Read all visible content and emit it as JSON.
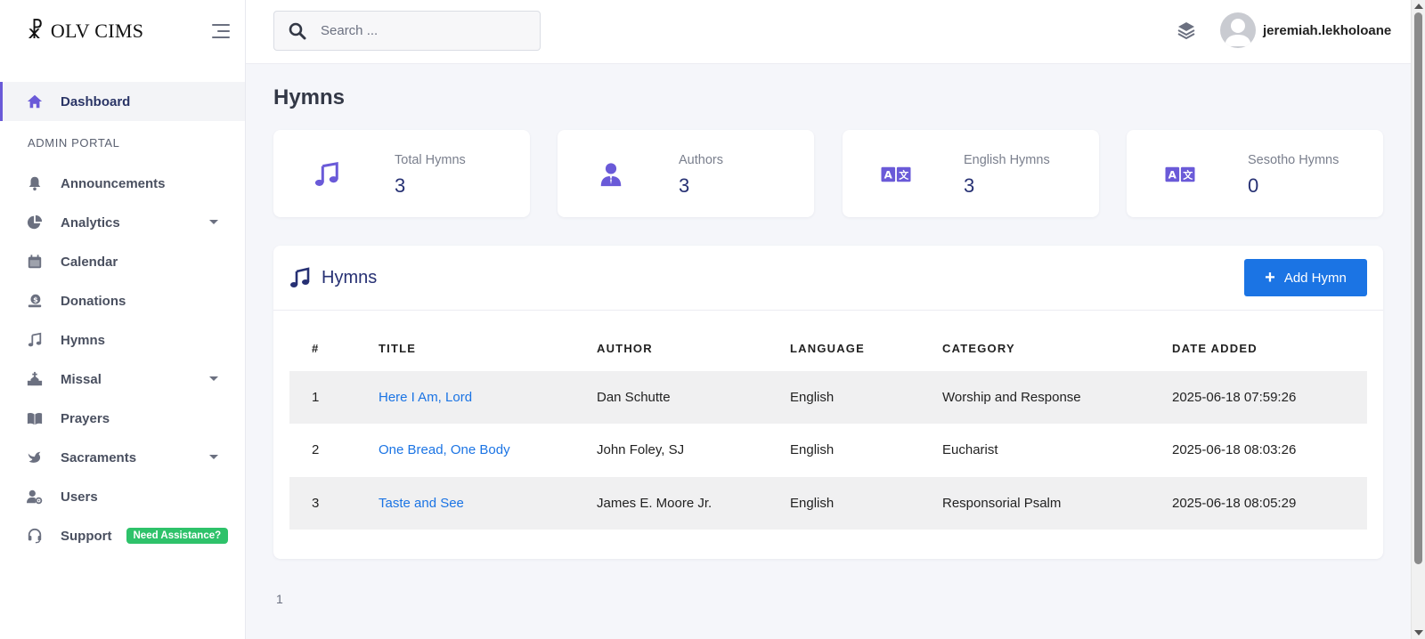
{
  "brand": {
    "mark": "☧",
    "name": "OLV CIMS"
  },
  "sidebar": {
    "dashboard": "Dashboard",
    "section_title": "ADMIN PORTAL",
    "items": [
      {
        "label": "Announcements",
        "icon": "bell-icon"
      },
      {
        "label": "Analytics",
        "icon": "pie-chart-icon",
        "caret": true
      },
      {
        "label": "Calendar",
        "icon": "calendar-icon"
      },
      {
        "label": "Donations",
        "icon": "donation-icon"
      },
      {
        "label": "Hymns",
        "icon": "music-note-icon"
      },
      {
        "label": "Missal",
        "icon": "church-icon",
        "caret": true
      },
      {
        "label": "Prayers",
        "icon": "book-icon"
      },
      {
        "label": "Sacraments",
        "icon": "dove-icon",
        "caret": true
      },
      {
        "label": "Users",
        "icon": "user-cog-icon"
      },
      {
        "label": "Support",
        "icon": "headset-icon",
        "badge": "Need Assistance?"
      }
    ]
  },
  "topbar": {
    "search_placeholder": "Search ...",
    "username": "jeremiah.lekholoane"
  },
  "page": {
    "title": "Hymns"
  },
  "stats": [
    {
      "label": "Total Hymns",
      "value": "3",
      "icon": "music-note-icon"
    },
    {
      "label": "Authors",
      "value": "3",
      "icon": "user-tie-icon"
    },
    {
      "label": "English Hymns",
      "value": "3",
      "icon": "language-icon"
    },
    {
      "label": "Sesotho Hymns",
      "value": "0",
      "icon": "language-icon"
    }
  ],
  "table_card": {
    "title": "Hymns",
    "add_button": "Add Hymn",
    "columns": [
      "#",
      "TITLE",
      "AUTHOR",
      "LANGUAGE",
      "CATEGORY",
      "DATE ADDED"
    ],
    "rows": [
      {
        "num": "1",
        "title": "Here I Am, Lord",
        "author": "Dan Schutte",
        "language": "English",
        "category": "Worship and Response",
        "date": "2025-06-18 07:59:26"
      },
      {
        "num": "2",
        "title": "One Bread, One Body",
        "author": "John Foley, SJ",
        "language": "English",
        "category": "Eucharist",
        "date": "2025-06-18 08:03:26"
      },
      {
        "num": "3",
        "title": "Taste and See",
        "author": "James E. Moore Jr.",
        "language": "English",
        "category": "Responsorial Psalm",
        "date": "2025-06-18 08:05:29"
      }
    ]
  },
  "pagination": {
    "page": "1"
  },
  "colors": {
    "accent": "#6a5ad8",
    "primary": "#1b74e4",
    "heading": "#263073",
    "badge": "#2ec26a"
  }
}
